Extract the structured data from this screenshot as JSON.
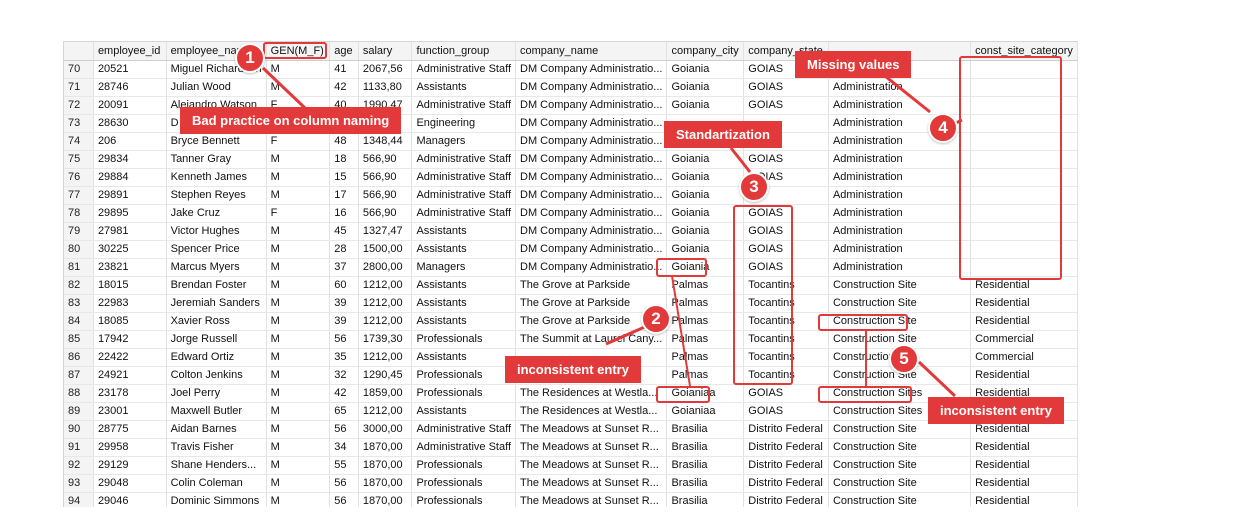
{
  "columns": [
    "",
    "employee_id",
    "employee_name",
    "GEN(M_F)",
    "age",
    "salary",
    "function_group",
    "company_name",
    "company_city",
    "company_state",
    "",
    "const_site_category"
  ],
  "rows": [
    [
      "70",
      "20521",
      "Miguel Richardson",
      "M",
      "41",
      "2067,56",
      "Administrative Staff",
      "DM Company Administratio...",
      "Goiania",
      "GOIAS",
      "",
      ""
    ],
    [
      "71",
      "28746",
      "Julian Wood",
      "M",
      "42",
      "1133,80",
      "Assistants",
      "DM Company Administratio...",
      "Goiania",
      "GOIAS",
      "Administration",
      ""
    ],
    [
      "72",
      "20091",
      "Alejandro Watson",
      "F",
      "40",
      "1990,47",
      "Administrative Staff",
      "DM Company Administratio...",
      "Goiania",
      "GOIAS",
      "Administration",
      ""
    ],
    [
      "73",
      "28630",
      "D",
      "",
      "",
      "",
      "Engineering",
      "DM Company Administratio...",
      "",
      "",
      "Administration",
      ""
    ],
    [
      "74",
      "206",
      "Bryce Bennett",
      "F",
      "48",
      "1348,44",
      "Managers",
      "DM Company Administratio...",
      "",
      "",
      "Administration",
      ""
    ],
    [
      "75",
      "29834",
      "Tanner Gray",
      "M",
      "18",
      "566,90",
      "Administrative Staff",
      "DM Company Administratio...",
      "Goiania",
      "GOIAS",
      "Administration",
      ""
    ],
    [
      "76",
      "29884",
      "Kenneth James",
      "M",
      "15",
      "566,90",
      "Administrative Staff",
      "DM Company Administratio...",
      "Goiania",
      "GOIAS",
      "Administration",
      ""
    ],
    [
      "77",
      "29891",
      "Stephen Reyes",
      "M",
      "17",
      "566,90",
      "Administrative Staff",
      "DM Company Administratio...",
      "Goiania",
      "",
      "Administration",
      ""
    ],
    [
      "78",
      "29895",
      "Jake Cruz",
      "F",
      "16",
      "566,90",
      "Administrative Staff",
      "DM Company Administratio...",
      "Goiania",
      "GOIAS",
      "Administration",
      ""
    ],
    [
      "79",
      "27981",
      "Victor Hughes",
      "M",
      "45",
      "1327,47",
      "Assistants",
      "DM Company Administratio...",
      "Goiania",
      "GOIAS",
      "Administration",
      ""
    ],
    [
      "80",
      "30225",
      "Spencer Price",
      "M",
      "28",
      "1500,00",
      "Assistants",
      "DM Company Administratio...",
      "Goiania",
      "GOIAS",
      "Administration",
      ""
    ],
    [
      "81",
      "23821",
      "Marcus Myers",
      "M",
      "37",
      "2800,00",
      "Managers",
      "DM Company Administratio...",
      "Goiania",
      "GOIAS",
      "Administration",
      ""
    ],
    [
      "82",
      "18015",
      "Brendan Foster",
      "M",
      "60",
      "1212,00",
      "Assistants",
      "The Grove at Parkside",
      "Palmas",
      "Tocantins",
      "Construction Site",
      "Residential"
    ],
    [
      "83",
      "22983",
      "Jeremiah Sanders",
      "M",
      "39",
      "1212,00",
      "Assistants",
      "The Grove at Parkside",
      "Palmas",
      "Tocantins",
      "Construction Site",
      "Residential"
    ],
    [
      "84",
      "18085",
      "Xavier Ross",
      "M",
      "39",
      "1212,00",
      "Assistants",
      "The Grove at Parkside",
      "Palmas",
      "Tocantins",
      "Construction Site",
      "Residential"
    ],
    [
      "85",
      "17942",
      "Jorge Russell",
      "M",
      "56",
      "1739,30",
      "Professionals",
      "The Summit at Laurel Cany...",
      "Palmas",
      "Tocantins",
      "Construction Site",
      "Commercial"
    ],
    [
      "86",
      "22422",
      "Edward Ortiz",
      "M",
      "35",
      "1212,00",
      "Assistants",
      "",
      "Palmas",
      "Tocantins",
      "Construction Site",
      "Commercial"
    ],
    [
      "87",
      "24921",
      "Colton Jenkins",
      "M",
      "32",
      "1290,45",
      "Professionals",
      "",
      "Palmas",
      "Tocantins",
      "Construction Site",
      "Residential"
    ],
    [
      "88",
      "23178",
      "Joel Perry",
      "M",
      "42",
      "1859,00",
      "Professionals",
      "The Residences at Westla...",
      "Goianiaa",
      "GOIAS",
      "Construction Sites",
      "Residential"
    ],
    [
      "89",
      "23001",
      "Maxwell Butler",
      "M",
      "65",
      "1212,00",
      "Assistants",
      "The Residences at Westla...",
      "Goianiaa",
      "GOIAS",
      "Construction Sites",
      "Residential"
    ],
    [
      "90",
      "28775",
      "Aidan Barnes",
      "M",
      "56",
      "3000,00",
      "Administrative Staff",
      "The Meadows at Sunset R...",
      "Brasilia",
      "Distrito Federal",
      "Construction Site",
      "Residential"
    ],
    [
      "91",
      "29958",
      "Travis Fisher",
      "M",
      "34",
      "1870,00",
      "Administrative Staff",
      "The Meadows at Sunset R...",
      "Brasilia",
      "Distrito Federal",
      "Construction Site",
      "Residential"
    ],
    [
      "92",
      "29129",
      "Shane Henders...",
      "M",
      "55",
      "1870,00",
      "Professionals",
      "The Meadows at Sunset R...",
      "Brasilia",
      "Distrito Federal",
      "Construction Site",
      "Residential"
    ],
    [
      "93",
      "29048",
      "Colin Coleman",
      "M",
      "56",
      "1870,00",
      "Professionals",
      "The Meadows at Sunset R...",
      "Brasilia",
      "Distrito Federal",
      "Construction Site",
      "Residential"
    ],
    [
      "94",
      "29046",
      "Dominic Simmons",
      "M",
      "56",
      "1870,00",
      "Professionals",
      "The Meadows at Sunset R...",
      "Brasilia",
      "Distrito Federal",
      "Construction Site",
      "Residential"
    ]
  ],
  "annotations": {
    "a1": {
      "number": "1",
      "label": "Bad practice on column naming"
    },
    "a2": {
      "number": "2",
      "label": "inconsistent entry"
    },
    "a3": {
      "number": "3",
      "label": "Standartization"
    },
    "a4": {
      "number": "4",
      "label": "Missing values"
    },
    "a5": {
      "number": "5",
      "label": "inconsistent entry"
    }
  },
  "colors": {
    "annotation": "#e23a3a",
    "header_bg": "#f4f4f4",
    "grid_line": "#e2e2e2"
  }
}
